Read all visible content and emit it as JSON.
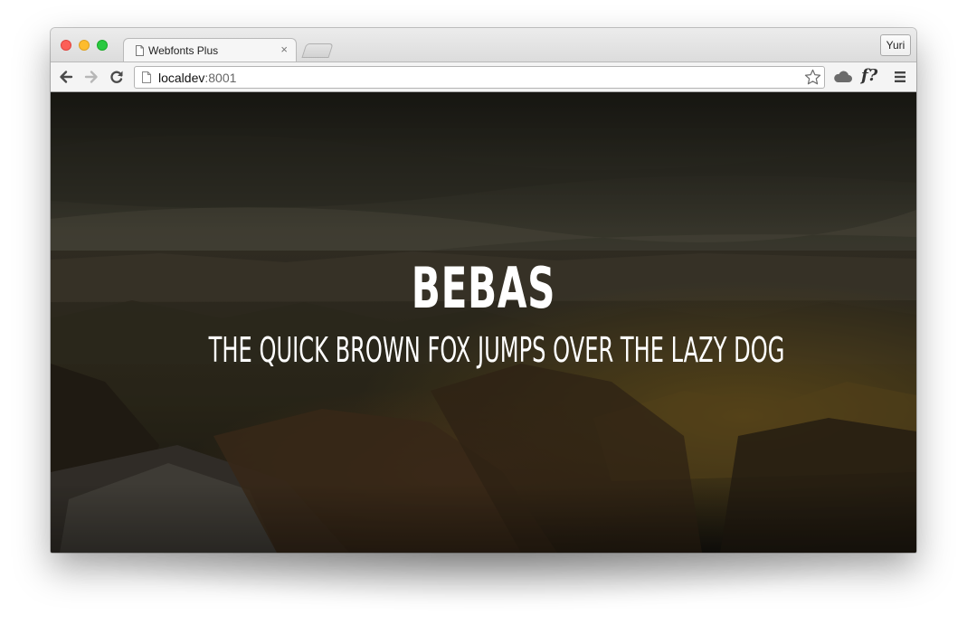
{
  "browser": {
    "tab": {
      "title": "Webfonts Plus",
      "close_glyph": "×",
      "favicon": "page-icon"
    },
    "profile_button": "Yuri",
    "address": {
      "host": "localdev",
      "port": ":8001"
    },
    "toolbar_icons": [
      "back-arrow-icon",
      "forward-arrow-icon",
      "reload-icon",
      "bookmark-star-icon",
      "cloud-icon",
      "font-detect-icon",
      "menu-icon"
    ],
    "font_extension_label": "f?"
  },
  "page": {
    "title": "BEBAS",
    "subtitle": "THE QUICK BROWN FOX JUMPS OVER THE LAZY DOG"
  }
}
